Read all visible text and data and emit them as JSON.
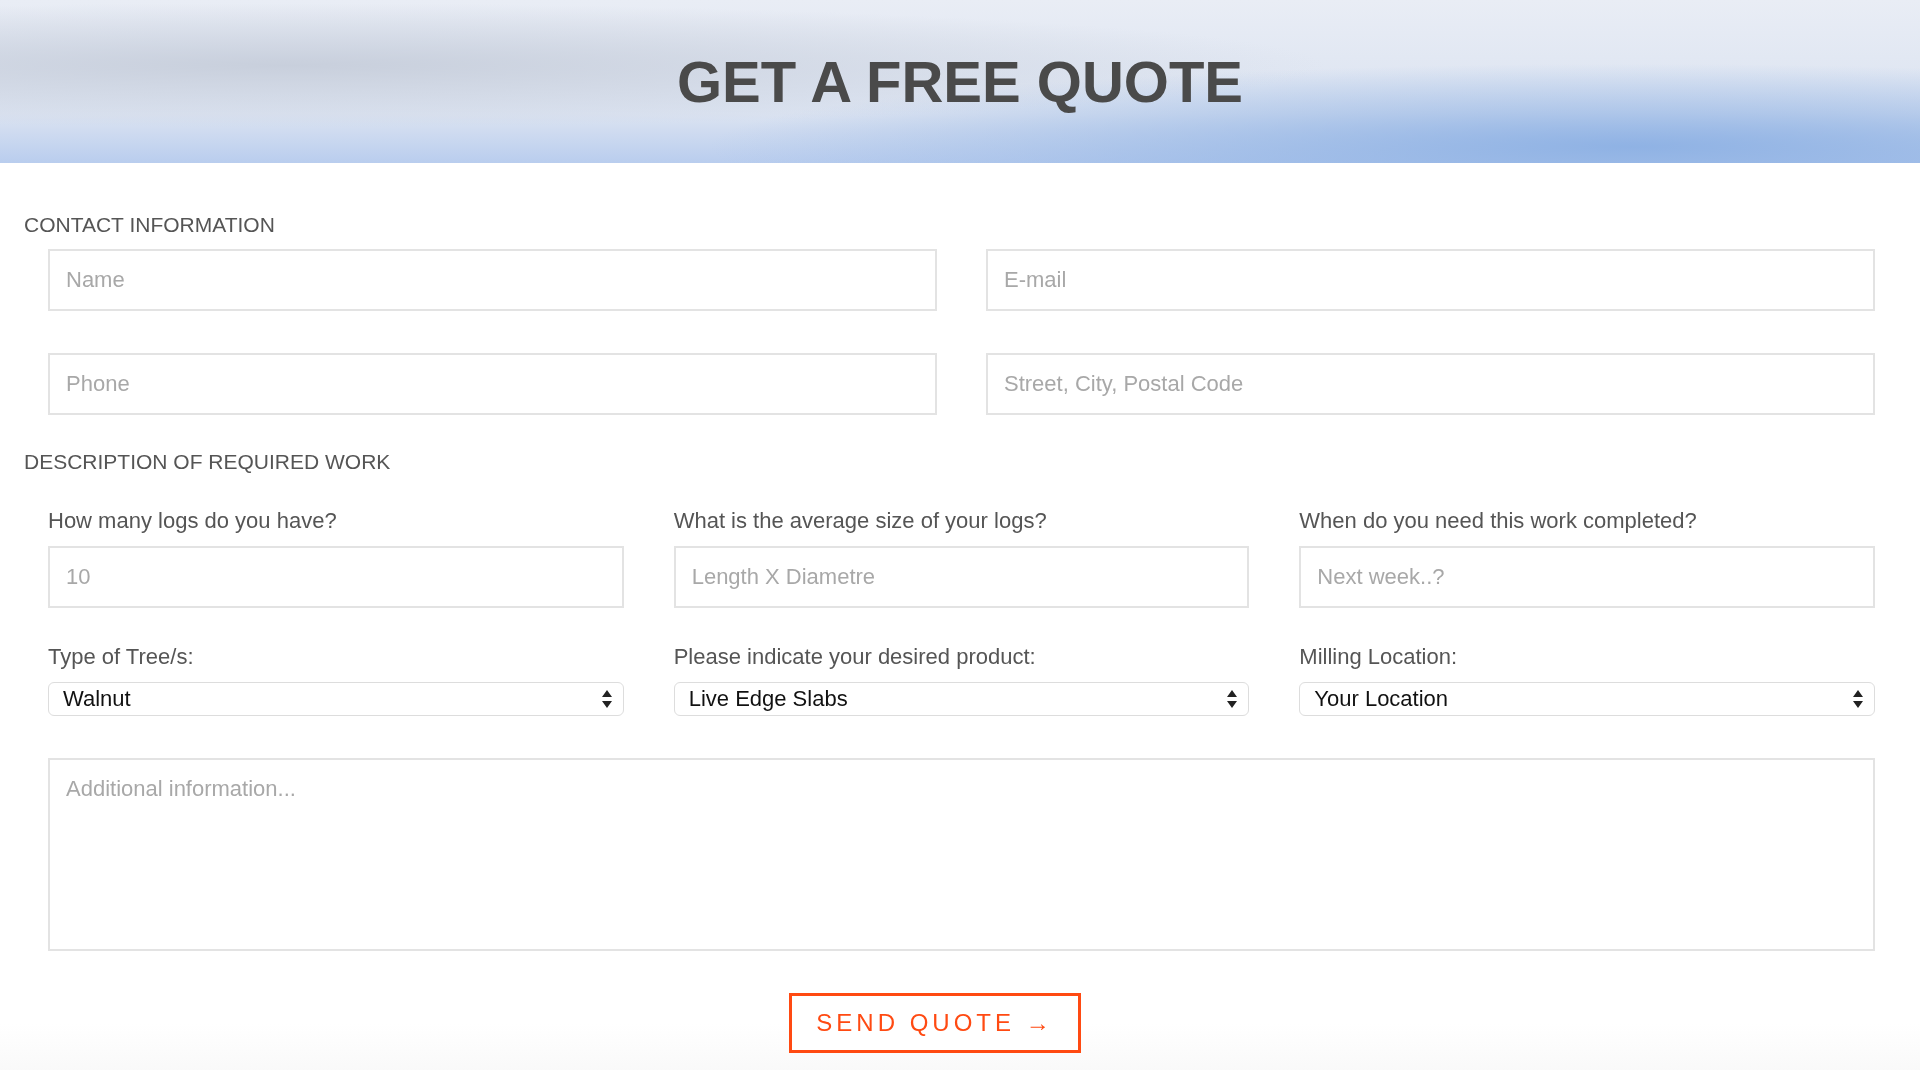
{
  "header": {
    "title": "GET A FREE QUOTE"
  },
  "contact": {
    "heading": "CONTACT INFORMATION",
    "fields": [
      {
        "placeholder": "Name"
      },
      {
        "placeholder": "E-mail"
      },
      {
        "placeholder": "Phone"
      },
      {
        "placeholder": "Street, City, Postal Code"
      }
    ]
  },
  "work": {
    "heading": "DESCRIPTION OF REQUIRED WORK",
    "questions": [
      {
        "label": "How many logs do you have?",
        "kind": "input",
        "placeholder": "10"
      },
      {
        "label": "What is the average size of your logs?",
        "kind": "input",
        "placeholder": "Length X Diametre"
      },
      {
        "label": "When do you need this work completed?",
        "kind": "input",
        "placeholder": "Next week..?"
      },
      {
        "label": "Type of Tree/s:",
        "kind": "select",
        "value": "Walnut"
      },
      {
        "label": "Please indicate your desired product:",
        "kind": "select",
        "value": "Live Edge Slabs"
      },
      {
        "label": "Milling Location:",
        "kind": "select",
        "value": "Your Location"
      }
    ],
    "additional": {
      "placeholder": "Additional information..."
    }
  },
  "submit": {
    "label": "SEND QUOTE →"
  }
}
